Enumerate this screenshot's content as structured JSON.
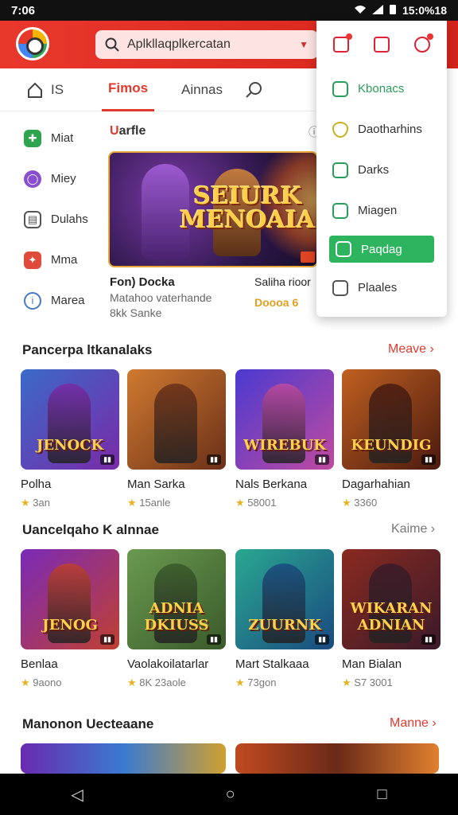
{
  "status_bar": {
    "time": "7:06",
    "battery": "15:0%18"
  },
  "search": {
    "placeholder": "Aplkllaqplkercatan"
  },
  "tabs": [
    {
      "label": "IS"
    },
    {
      "label": "Fimos"
    },
    {
      "label": "Ainnas"
    }
  ],
  "sidebar": {
    "items": [
      {
        "label": "Miat",
        "icon": "puzzle-icon",
        "color": "#2ea44f"
      },
      {
        "label": "Miey",
        "icon": "circle-icon",
        "color": "#8a4fd0"
      },
      {
        "label": "Dulahs",
        "icon": "book-icon",
        "color": "#555555"
      },
      {
        "label": "Mma",
        "icon": "gamepad-icon",
        "color": "#e04a3a"
      },
      {
        "label": "Marea",
        "icon": "info-icon",
        "color": "#4a78c0"
      }
    ]
  },
  "featured": {
    "title_prefix": "U",
    "title_rest": "arfle",
    "banner_title_line1": "SEIURK",
    "banner_title_line2": "MENOAIA",
    "card1_name": "Fon) Docka",
    "card1_sub1": "Matahoo vaterhande",
    "card1_sub2": "8kk Sanke",
    "card2_name": "Saliha rioor",
    "card2_rating": "Doooa 6"
  },
  "dropdown": {
    "items": [
      {
        "label": "Kbonacs",
        "icon": "chat-icon"
      },
      {
        "label": "Daotharhins",
        "icon": "shield-icon"
      },
      {
        "label": "Darks",
        "icon": "tag-icon"
      },
      {
        "label": "Miagen",
        "icon": "square-icon"
      },
      {
        "label": "Paqdag",
        "icon": "tools-icon"
      },
      {
        "label": "Plaales",
        "icon": "store-icon"
      }
    ]
  },
  "sections": [
    {
      "title": "Pancerpa ltkanalaks",
      "more": "Meave",
      "cards": [
        {
          "name": "Polha",
          "meta": "3an",
          "art": "JENOCK",
          "colors": [
            "#3a6ac8",
            "#7a2aa8"
          ]
        },
        {
          "name": "Man Sarka",
          "meta": "15anle",
          "art": "",
          "colors": [
            "#d07a30",
            "#6a3018"
          ]
        },
        {
          "name": "Nals Berkana",
          "meta": "58001",
          "art": "WIREBUK",
          "colors": [
            "#4a3ad0",
            "#c04aa0"
          ]
        },
        {
          "name": "Dagarhahian",
          "meta": "3360",
          "art": "KEUNDIG",
          "colors": [
            "#c06020",
            "#4a1a10"
          ]
        }
      ]
    },
    {
      "title": "Uancelqaho K alnnae",
      "more": "Kaime",
      "cards": [
        {
          "name": "Benlaa",
          "meta": "9aono",
          "art": "JENOG",
          "colors": [
            "#7a2ab8",
            "#c04030"
          ]
        },
        {
          "name": "Vaolakoilatarlar",
          "meta": "8K 23aole",
          "art": "ADNIA DKIUSS",
          "colors": [
            "#6a9a50",
            "#3a5a2a"
          ]
        },
        {
          "name": "Mart Stalkaaa",
          "meta": "73gon",
          "art": "ZUURNK",
          "colors": [
            "#2aa890",
            "#1a4a80"
          ]
        },
        {
          "name": "Man Bialan",
          "meta": "S7 3001",
          "art": "WIKARAN ADNIAN",
          "colors": [
            "#8a2a20",
            "#3a1a2a"
          ]
        }
      ]
    },
    {
      "title": "Manonon Uecteaane",
      "more": "Manne"
    }
  ]
}
